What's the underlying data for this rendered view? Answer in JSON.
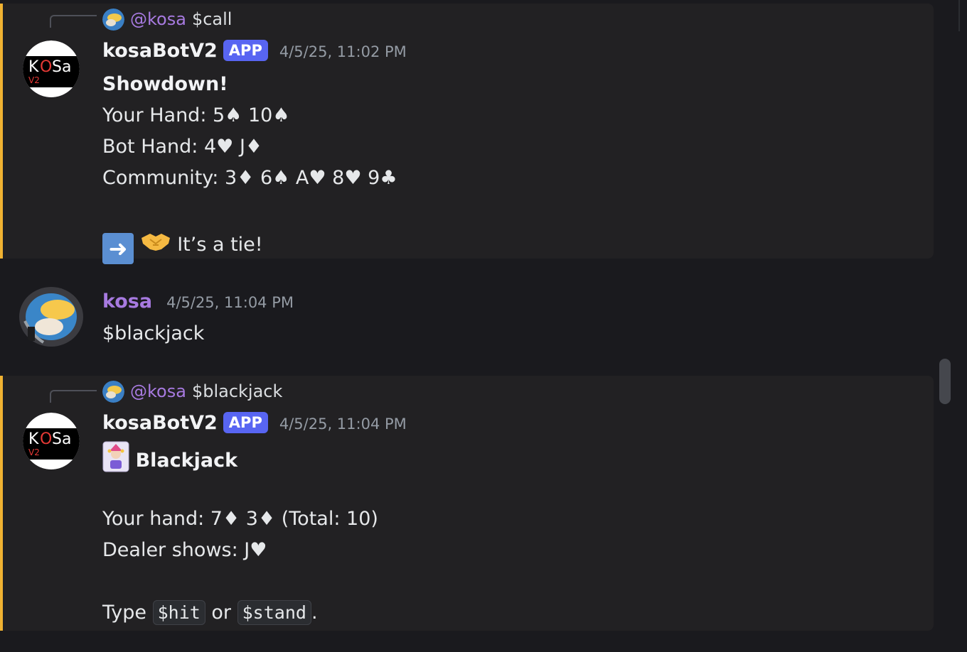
{
  "messages": {
    "showdown": {
      "reply": {
        "mention": "@kosa",
        "text": "$call"
      },
      "author": "kosaBotV2",
      "badge": "APP",
      "timestamp": "4/5/25, 11:02 PM",
      "avatar_logo": {
        "k": "K",
        "o": "O",
        "sa": "Sa",
        "v2": "V2"
      },
      "title": "Showdown!",
      "your_hand": "Your Hand: 5♠ 10♠",
      "bot_hand": "Bot Hand: 4♥ J♦",
      "community": "Community: 3♦ 6♠ A♥ 8♥ 9♣",
      "result": "It’s a tie!"
    },
    "user": {
      "author": "kosa",
      "timestamp": "4/5/25, 11:04 PM",
      "text": "$blackjack"
    },
    "blackjack": {
      "reply": {
        "mention": "@kosa",
        "text": "$blackjack"
      },
      "author": "kosaBotV2",
      "badge": "APP",
      "timestamp": "4/5/25, 11:04 PM",
      "avatar_logo": {
        "k": "K",
        "o": "O",
        "sa": "Sa",
        "v2": "V2"
      },
      "title": "Blackjack",
      "your_hand": "Your hand: 7♦ 3♦ (Total: 10)",
      "dealer": "Dealer shows: J♥",
      "type_prefix": "Type ",
      "cmd_hit": "$hit",
      "or_text": " or ",
      "cmd_stand": "$stand",
      "period": "."
    }
  },
  "icons": {
    "arrow_emoji": "right-arrow-icon",
    "handshake_emoji": "handshake-icon",
    "joker_emoji": "joker-card-icon"
  },
  "colors": {
    "background": "#1a1a1e",
    "highlight": "#222123",
    "highlight_bar": "#f0b232",
    "app_badge": "#5865f2",
    "user_name": "#a77ae0",
    "timestamp": "#949ba4"
  }
}
